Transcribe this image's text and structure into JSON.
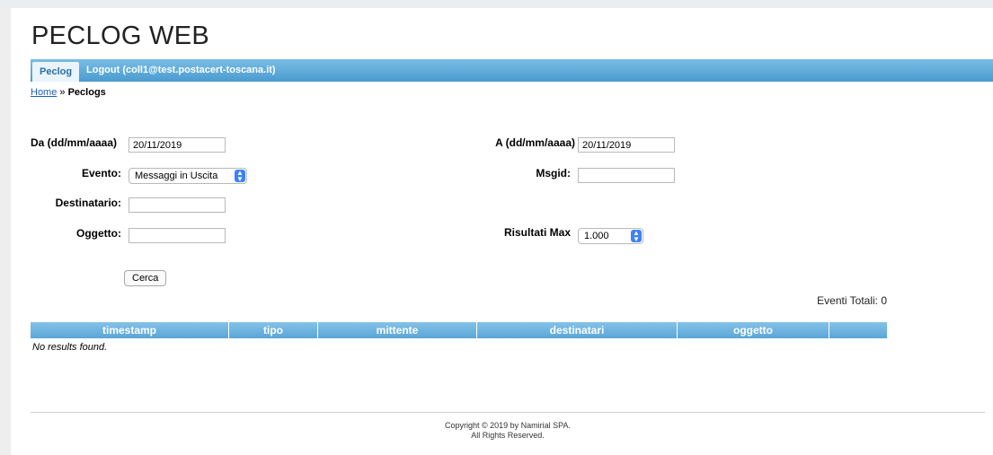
{
  "app": {
    "title": "PECLOG WEB"
  },
  "nav": {
    "active_tab": "Peclog",
    "logout_label": "Logout (coll1@test.postacert-toscana.it)"
  },
  "breadcrumb": {
    "home": "Home",
    "separator": "»",
    "current": "Peclogs"
  },
  "form": {
    "da_label": "Da (dd/mm/aaaa)",
    "da_value": "20/11/2019",
    "a_label": "A (dd/mm/aaaa)",
    "a_value": "20/11/2019",
    "evento_label": "Evento:",
    "evento_value": "Messaggi in Uscita",
    "msgid_label": "Msgid:",
    "msgid_value": "",
    "destinatario_label": "Destinatario:",
    "destinatario_value": "",
    "oggetto_label": "Oggetto:",
    "oggetto_value": "",
    "risultati_label": "Risultati Max",
    "risultati_value": "1.000",
    "submit_label": "Cerca"
  },
  "results": {
    "totals_text": "Eventi Totali: 0",
    "columns": [
      "timestamp",
      "tipo",
      "mittente",
      "destinatari",
      "oggetto",
      ""
    ],
    "empty_text": "No results found."
  },
  "footer": {
    "copyright": "Copyright © 2019 by Namirial SPA.",
    "rights": "All Rights Reserved."
  },
  "colors": {
    "nav_blue": "#4a9bd0",
    "header_blue": "#5aa6d8",
    "link": "#1f5fb4",
    "select_arrow": "#3b82f6"
  }
}
